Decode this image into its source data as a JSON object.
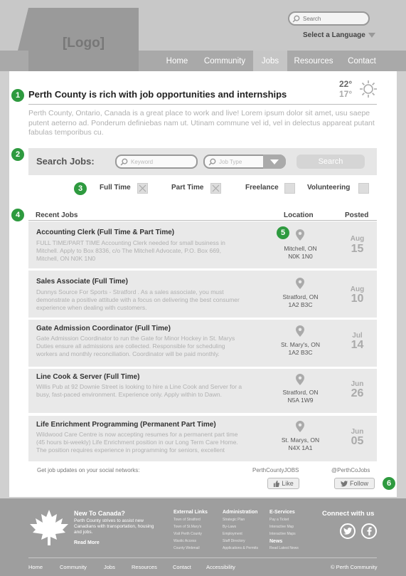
{
  "header": {
    "logo_text": "[Logo]",
    "search_placeholder": "Search",
    "language_label": "Select a Language"
  },
  "nav": {
    "items": [
      "Home",
      "Community",
      "Jobs",
      "Resources",
      "Contact"
    ],
    "active": "Jobs"
  },
  "main": {
    "headline": "Perth County is rich with job opportunities and internships",
    "weather": {
      "high": "22°",
      "low": "17°",
      "icon": "sun-icon"
    },
    "intro": "Perth County, Ontario, Canada is a great place to work and live!   Lorem ipsum dolor sit amet, usu saepe putent aeterno ad. Ponderum definiebas nam ut. Utinam commune vel id, vel in delectus appareat putant fabulas temporibus cu."
  },
  "markers": [
    "1",
    "2",
    "3",
    "4",
    "5",
    "6"
  ],
  "search": {
    "label": "Search Jobs:",
    "keyword_placeholder": "Keyword",
    "jobtype_placeholder": "Job Type",
    "button_label": "Search"
  },
  "filters": [
    {
      "label": "Full Time",
      "checked": true
    },
    {
      "label": "Part Time",
      "checked": true
    },
    {
      "label": "Freelance",
      "checked": false
    },
    {
      "label": "Volunteering",
      "checked": false
    }
  ],
  "jobs_table": {
    "headers": {
      "recent": "Recent Jobs",
      "location": "Location",
      "posted": "Posted"
    },
    "rows": [
      {
        "title": "Accounting Clerk (Full Time & Part Time)",
        "desc": "FULL TIME/PART TIME Accounting Clerk needed for small business in Mitchell. Apply to Box 8336, c/o The Mitchell Advocate, P.O. Box 669, Mitchell, ON N0K 1N0",
        "city": "Mitchell, ON",
        "postal": "N0K 1N0",
        "month": "Aug",
        "day": "15"
      },
      {
        "title": "Sales Associate (Full Time)",
        "desc": "Dunnys Source For Sports - Stratford . As a sales associate, you must demonstrate a positive attitude with a focus on delivering the best consumer experience when dealing with customers.",
        "city": "Stratford, ON",
        "postal": "1A2 B3C",
        "month": "Aug",
        "day": "10"
      },
      {
        "title": "Gate Admission Coordinator (Full Time)",
        "desc": "Gate Admission Coordinator to run the Gate for Minor Hockey in St. Marys Duties ensure all admissions are collected. Responsible for scheduling workers and monthly reconciliation. Coordinator will be paid monthly.",
        "city": "St. Mary's, ON",
        "postal": "1A2 B3C",
        "month": "Jul",
        "day": "14"
      },
      {
        "title": "Line Cook & Server (Full Time)",
        "desc": "Willis Pub at 92 Downie Street is looking to hire a Line Cook and Server for a busy, fast-paced environment. Experience only. Apply within to Dawn.",
        "city": "Stratford, ON",
        "postal": "N5A 1W9",
        "month": "Jun",
        "day": "26"
      },
      {
        "title": "Life Enrichment Programming (Permanent Part Time)",
        "desc": "Wildwood Care Centre is now accepting resumes for a permanent part time (45 hours bi-weekly) Life Enrichment position in our Long Term Care Home. The position requires experience in programming for seniors, excellent",
        "city": "St. Marys, ON",
        "postal": "N4X 1A1",
        "month": "Jun",
        "day": "05"
      }
    ]
  },
  "social": {
    "prompt": "Get job updates on your social networks:",
    "facebook_name": "PerthCountyJOBS",
    "facebook_button": "Like",
    "twitter_name": "@PerthCoJobs",
    "twitter_button": "Follow"
  },
  "footer": {
    "newcomer_title": "New To Canada?",
    "newcomer_text": "Perth County strives to assist new Canadians with transportation, housing and jobs.",
    "read_more": "Read More",
    "columns": [
      {
        "title": "External Links",
        "links": [
          "Town of Stratford",
          "Town of St.Mary's",
          "Visit Perth County",
          "Wastic Access",
          "County Webmail"
        ]
      },
      {
        "title": "Administration",
        "links": [
          "Strategic Plan",
          "By-Laws",
          "Employment",
          "Staff Directory",
          "Applications & Permits"
        ]
      },
      {
        "title": "E-Services",
        "links": [
          "Pay a Ticket",
          "Interactive Map",
          "Interactive Maps"
        ]
      }
    ],
    "news_title": "News",
    "news_link": "Read Latest News",
    "connect_title": "Connect with us",
    "bottom_nav": [
      "Home",
      "Community",
      "Jobs",
      "Resources",
      "Contact",
      "Accessibility"
    ],
    "copyright": "© Perth Community"
  }
}
